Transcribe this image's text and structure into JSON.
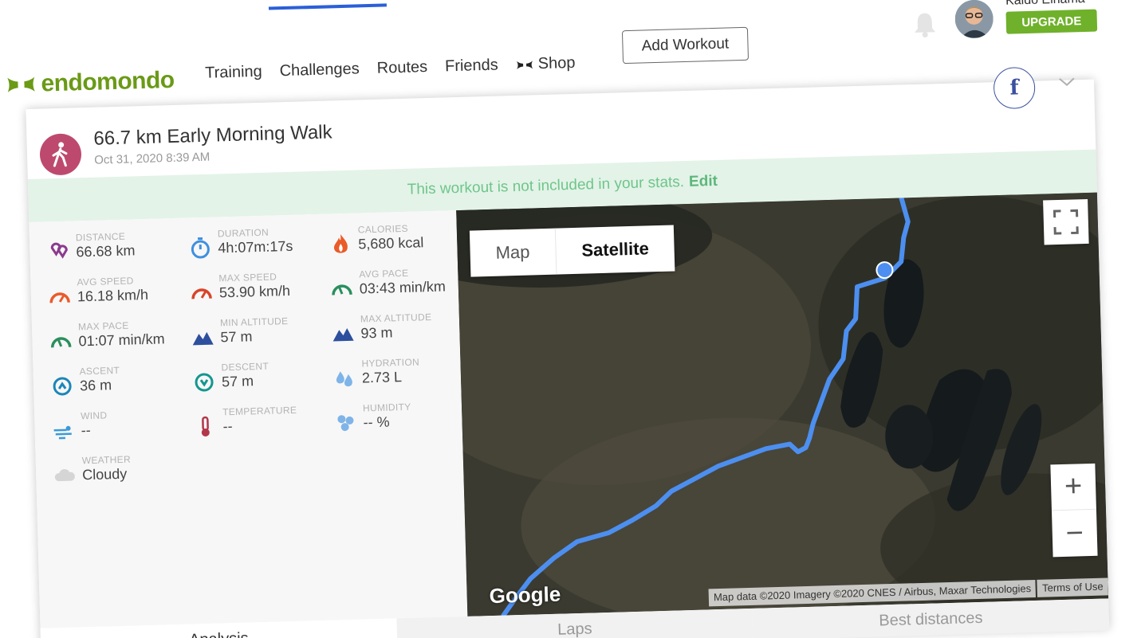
{
  "header": {
    "brand": "endomondo",
    "nav": [
      "Training",
      "Challenges",
      "Routes",
      "Friends",
      "Shop"
    ],
    "add_workout": "Add Workout",
    "user_name": "Kaido Einama",
    "upgrade": "UPGRADE"
  },
  "workout": {
    "title": "66.7 km Early Morning Walk",
    "date": "Oct 31, 2020 8:39 AM",
    "banner_text": "This workout is not included in your stats.",
    "banner_link": "Edit",
    "sport_color": "#bd4a6e",
    "stats": [
      {
        "label": "DISTANCE",
        "value": "66.68 km",
        "icon": "distance-icon",
        "color": "#8b3b8f"
      },
      {
        "label": "DURATION",
        "value": "4h:07m:17s",
        "icon": "stopwatch-icon",
        "color": "#3f8fe0"
      },
      {
        "label": "CALORIES",
        "value": "5,680 kcal",
        "icon": "flame-icon",
        "color": "#ea5b2a"
      },
      {
        "label": "AVG SPEED",
        "value": "16.18 km/h",
        "icon": "speedometer-icon",
        "color": "#ea5b2a"
      },
      {
        "label": "MAX SPEED",
        "value": "53.90 km/h",
        "icon": "speedometer-icon",
        "color": "#d9442a"
      },
      {
        "label": "AVG PACE",
        "value": "03:43 min/km",
        "icon": "pace-gauge-icon",
        "color": "#2a8f5d"
      },
      {
        "label": "MAX PACE",
        "value": "01:07 min/km",
        "icon": "pace-gauge-icon",
        "color": "#2a8f5d"
      },
      {
        "label": "MIN ALTITUDE",
        "value": "57 m",
        "icon": "mountain-icon",
        "color": "#2d4f9e"
      },
      {
        "label": "MAX ALTITUDE",
        "value": "93 m",
        "icon": "mountain-icon",
        "color": "#2d4f9e"
      },
      {
        "label": "ASCENT",
        "value": "36 m",
        "icon": "ascent-icon",
        "color": "#1c86b8"
      },
      {
        "label": "DESCENT",
        "value": "57 m",
        "icon": "descent-icon",
        "color": "#13978f"
      },
      {
        "label": "HYDRATION",
        "value": "2.73 L",
        "icon": "drops-icon",
        "color": "#7fb4e8"
      },
      {
        "label": "WIND",
        "value": "--",
        "icon": "wind-icon",
        "color": "#3a9ad9"
      },
      {
        "label": "TEMPERATURE",
        "value": "--",
        "icon": "thermometer-icon",
        "color": "#b2374b"
      },
      {
        "label": "HUMIDITY",
        "value": "-- %",
        "icon": "humidity-icon",
        "color": "#7fb4e8"
      },
      {
        "label": "WEATHER",
        "value": "Cloudy",
        "icon": "cloud-icon",
        "color": "#d5d5d5"
      }
    ]
  },
  "map": {
    "toggle_map": "Map",
    "toggle_satellite": "Satellite",
    "zoom_in": "+",
    "zoom_out": "−",
    "google": "Google",
    "attribution": "Map data ©2020 Imagery ©2020 CNES / Airbus, Maxar Technologies",
    "terms": "Terms of Use",
    "route_color": "#4c8ff0"
  },
  "tabs": [
    "Analysis",
    "Laps",
    "Best distances"
  ]
}
